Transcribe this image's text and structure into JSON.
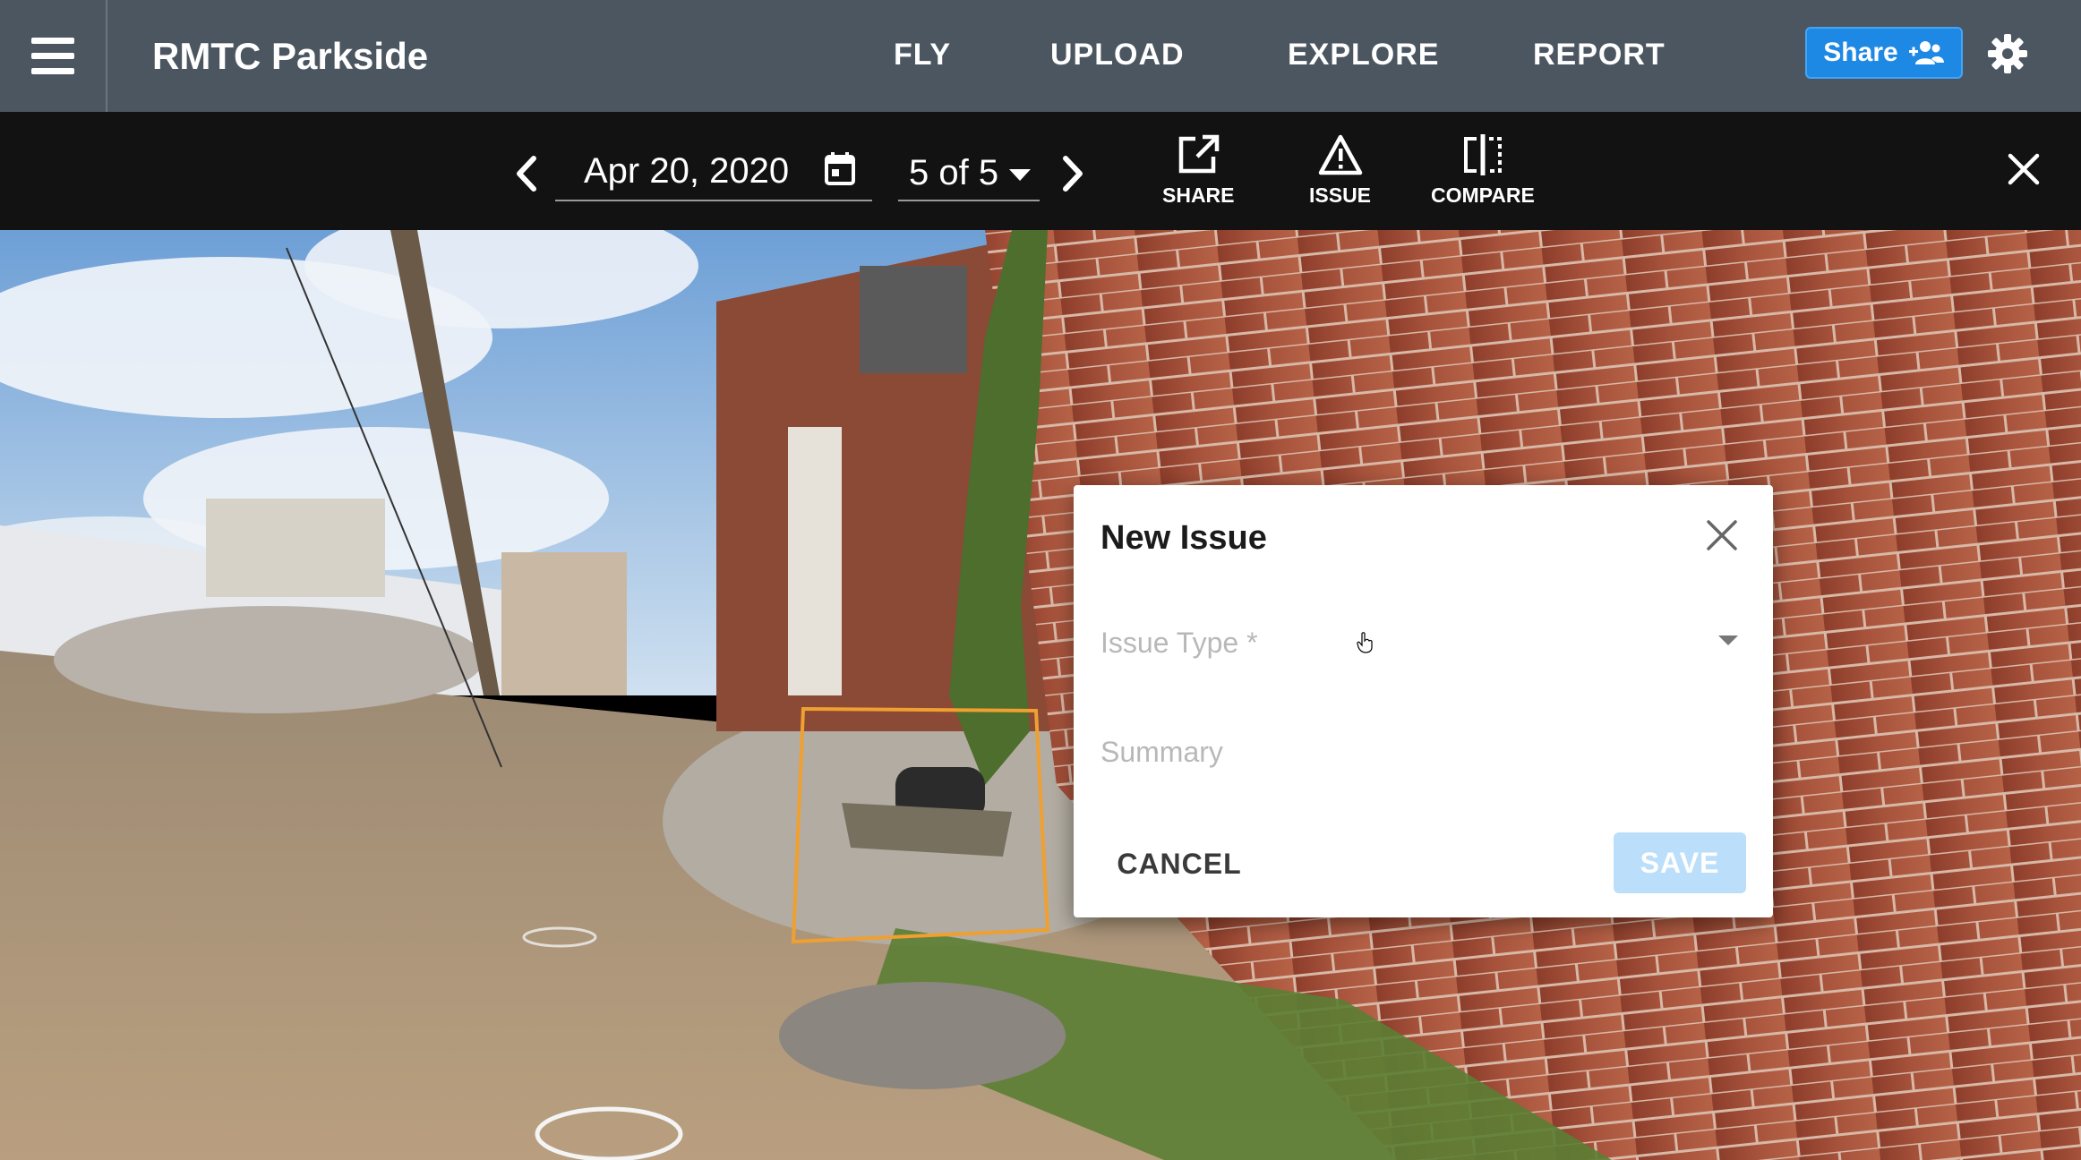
{
  "header": {
    "menu_icon": "hamburger-menu-icon",
    "title": "RMTC Parkside",
    "nav": [
      "FLY",
      "UPLOAD",
      "EXPLORE",
      "REPORT"
    ],
    "share_label": "Share",
    "share_icon": "add-people-icon",
    "settings_icon": "gear-icon",
    "accent": "#1e88e5",
    "bar_color": "#4c5661"
  },
  "toolbar": {
    "prev_icon": "chevron-left-icon",
    "date": "Apr 20, 2020",
    "calendar_icon": "calendar-icon",
    "capture_index": "5 of 5",
    "next_icon": "chevron-right-icon",
    "tools": [
      {
        "label": "SHARE",
        "icon": "external-link-icon"
      },
      {
        "label": "ISSUE",
        "icon": "warning-triangle-icon"
      },
      {
        "label": "COMPARE",
        "icon": "split-compare-icon"
      }
    ],
    "close_icon": "close-icon"
  },
  "dialog": {
    "title": "New Issue",
    "close_icon": "close-icon",
    "issue_type_label": "Issue Type *",
    "summary_placeholder": "Summary",
    "cancel_label": "CANCEL",
    "save_label": "SAVE",
    "save_color": "#bbdefb"
  },
  "scene": {
    "selection_color": "#f0a030"
  }
}
